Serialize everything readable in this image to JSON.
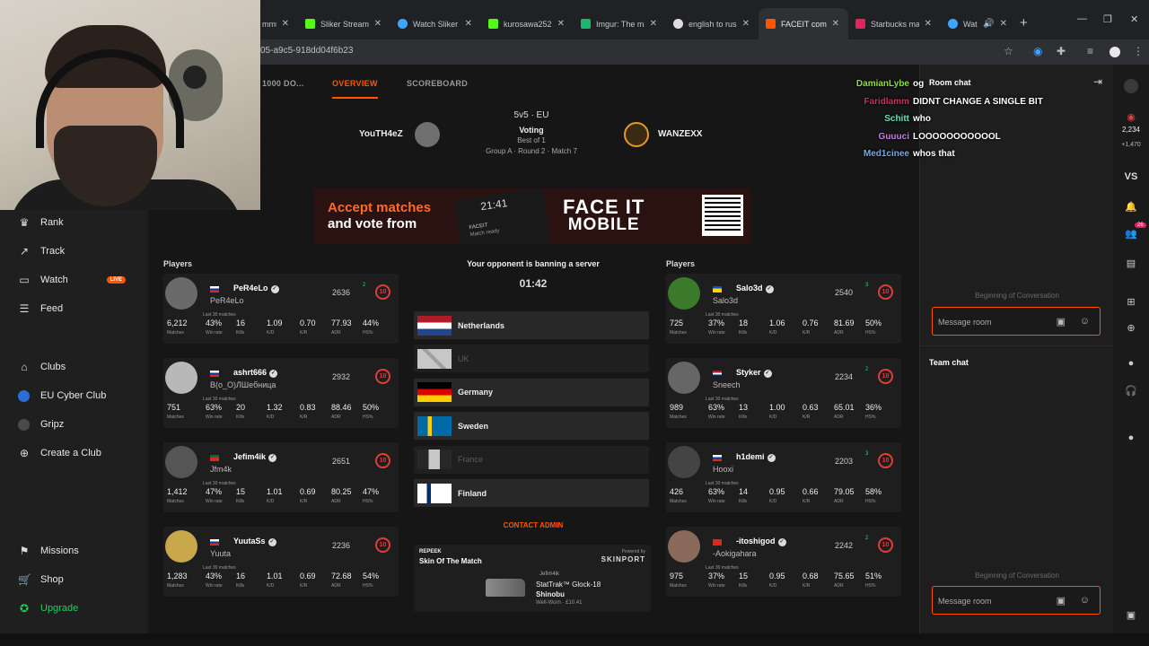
{
  "browser": {
    "tabs": [
      {
        "label": "mmu",
        "color": "#8a8a8a"
      },
      {
        "label": "Sliker Stream -",
        "color": "#53fc18"
      },
      {
        "label": "Watch Sliker 20",
        "color": "#3ea6ff"
      },
      {
        "label": "kurosawa2525",
        "color": "#53fc18"
      },
      {
        "label": "Imgur: The mag",
        "color": "#1bb76e"
      },
      {
        "label": "english to russi",
        "color": "#dddddd"
      },
      {
        "label": "FACEIT compet",
        "color": "#ff5500"
      },
      {
        "label": "Starbucks make",
        "color": "#e0245e"
      },
      {
        "label": "Watc",
        "color": "#3ea6ff"
      }
    ],
    "url": "05-a9c5-918dd04f6b23"
  },
  "sidebar": {
    "items": [
      {
        "label": "Rank",
        "icon": "rank-icon"
      },
      {
        "label": "Track",
        "icon": "track-icon"
      },
      {
        "label": "Watch",
        "icon": "watch-icon",
        "badge": "LIVE"
      },
      {
        "label": "Feed",
        "icon": "feed-icon"
      },
      {
        "label": "Clubs",
        "icon": "clubs-icon"
      },
      {
        "label": "EU Cyber Club",
        "icon": "club-icon"
      },
      {
        "label": "Gripz",
        "icon": "club-icon"
      },
      {
        "label": "Create a Club",
        "icon": "plus-icon"
      },
      {
        "label": "Missions",
        "icon": "missions-icon"
      },
      {
        "label": "Shop",
        "icon": "shop-icon"
      },
      {
        "label": "Upgrade",
        "icon": "upgrade-icon"
      }
    ]
  },
  "match": {
    "tabs": [
      "1000 DO...",
      "OVERVIEW",
      "SCOREBOARD"
    ],
    "team_left": "YouTH4eZ",
    "team_right": "WANZEXX",
    "mode": "5v5 · EU",
    "status": "Voting",
    "best_of": "Best of 1",
    "group": "Group A · Round 2 · Match 7"
  },
  "banner": {
    "line1": "Accept matches",
    "line2": "and vote from",
    "logo1": "FACE IT",
    "logo2": "MOBILE",
    "phone_time": "21:41",
    "phone_label": "FACEIT",
    "phone_sub": "Match ready"
  },
  "players_label": "Players",
  "last30": "Last 30 matches",
  "stat_keys": [
    "Matches",
    "Win rate",
    "Kills",
    "K/D",
    "K/R",
    "ADR",
    "HS%"
  ],
  "left_players": [
    {
      "name": "PeR4eLo",
      "nick": "PeR4eLo",
      "elo": "2636",
      "trend": "2",
      "level": "10",
      "flag_colors": [
        "#fff",
        "#0039a6",
        "#d52b1e"
      ],
      "stats": [
        "6,212",
        "43%",
        "16",
        "1.09",
        "0.70",
        "77.93",
        "44%"
      ]
    },
    {
      "name": "ashrt666",
      "nick": "В(о_О)ЛШебница",
      "elo": "2932",
      "trend": "",
      "level": "10",
      "flag_colors": [
        "#fff",
        "#0039a6",
        "#d52b1e"
      ],
      "stats": [
        "751",
        "63%",
        "20",
        "1.32",
        "0.83",
        "88.46",
        "50%"
      ]
    },
    {
      "name": "Jefim4ik",
      "nick": "Jfm4k",
      "elo": "2651",
      "trend": "",
      "level": "10",
      "flag_colors": [
        "#046a38",
        "#da291c",
        "#da291c"
      ],
      "stats": [
        "1,412",
        "47%",
        "15",
        "1.01",
        "0.69",
        "80.25",
        "47%"
      ]
    },
    {
      "name": "YuutaSs",
      "nick": "Yuuta",
      "elo": "2236",
      "trend": "",
      "level": "10",
      "flag_colors": [
        "#fff",
        "#0039a6",
        "#d52b1e"
      ],
      "stats": [
        "1,283",
        "43%",
        "16",
        "1.01",
        "0.69",
        "72.68",
        "54%"
      ]
    }
  ],
  "right_players": [
    {
      "name": "Salo3d",
      "nick": "Salo3d",
      "elo": "2540",
      "trend": "3",
      "level": "10",
      "flag_colors": [
        "#0057b7",
        "#ffd700",
        "#ffd700"
      ],
      "stats": [
        "725",
        "37%",
        "18",
        "1.06",
        "0.76",
        "81.69",
        "50%"
      ]
    },
    {
      "name": "Styker",
      "nick": "Sneech",
      "elo": "2234",
      "trend": "2",
      "level": "10",
      "flag_colors": [
        "#c8102e",
        "#fff",
        "#012169"
      ],
      "stats": [
        "989",
        "63%",
        "13",
        "1.00",
        "0.63",
        "65.01",
        "36%"
      ]
    },
    {
      "name": "h1demi",
      "nick": "Hooxi",
      "elo": "2203",
      "trend": "3",
      "level": "10",
      "flag_colors": [
        "#fff",
        "#0039a6",
        "#d52b1e"
      ],
      "stats": [
        "426",
        "63%",
        "14",
        "0.95",
        "0.66",
        "79.05",
        "58%"
      ]
    },
    {
      "name": "-itoshigod",
      "nick": "-Aokigahara",
      "elo": "2242",
      "trend": "2",
      "level": "10",
      "flag_colors": [
        "#da291c",
        "#da291c",
        "#da291c"
      ],
      "stats": [
        "975",
        "37%",
        "15",
        "0.95",
        "0.68",
        "75.65",
        "51%"
      ]
    }
  ],
  "veto": {
    "title": "Your opponent is banning a server",
    "timer": "01:42",
    "maps": [
      {
        "name": "Netherlands",
        "banned": false
      },
      {
        "name": "UK",
        "banned": true
      },
      {
        "name": "Germany",
        "banned": false
      },
      {
        "name": "Sweden",
        "banned": false
      },
      {
        "name": "France",
        "banned": true
      },
      {
        "name": "Finland",
        "banned": false
      }
    ],
    "contact": "CONTACT ADMIN"
  },
  "skin": {
    "brand": "REPEEK",
    "title": "Skin Of The Match",
    "powered": "Powered by",
    "sponsor": "SKINPORT",
    "owner": "Jefim4ik",
    "item": "StatTrak™ Glock-18",
    "item2": "Shinobu",
    "wear": "Well-Worn · £10.41"
  },
  "chat": {
    "room_title": "Room chat",
    "team_title": "Team chat",
    "beginning": "Beginning of Conversation",
    "placeholder": "Message room"
  },
  "overlay": [
    {
      "user": "DamianLybe",
      "color": "#8ae234",
      "msg": "og"
    },
    {
      "user": "Faridlamm",
      "color": "#e0245e",
      "msg": "DIDNT CHANGE A SINGLE BIT"
    },
    {
      "user": "Schitt",
      "color": "#6ce0b8",
      "msg": "who"
    },
    {
      "user": "Guuuci",
      "color": "#c879f2",
      "msg": "LOOOOOOOOOOOL"
    },
    {
      "user": "Med1cinee",
      "color": "#7aa7e8",
      "msg": "whos that"
    }
  ],
  "rail": {
    "count1": "2,234",
    "count2": "+1,470",
    "vs": "VS",
    "badge": "26"
  }
}
